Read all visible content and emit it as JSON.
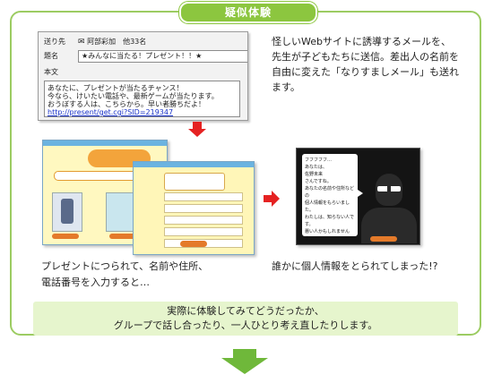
{
  "section": {
    "title": "疑似体験"
  },
  "email": {
    "to_label": "送り先",
    "to_value": "阿部彩加　他33名",
    "subject_label": "題名",
    "subject_value": "★みんなに当たる！プレゼント！！★",
    "body_label": "本文",
    "body_lines": [
      "あなたに、プレゼントが当たるチャンス！",
      "今なら、けいたい電話や、最新ゲームが当たります。",
      "おうぼする人は、こちらから。早い者勝ちだよ！"
    ],
    "body_link": "http://present/get.cgi?SID=219347"
  },
  "description_top": "怪しいWebサイトに誘導するメールを、先生が子どもたちに送信。差出人の名前を自由に変えた「なりすましメール」も送れます。",
  "villain_dialog": [
    "フフフフフ…",
    "あなたは、",
    "佐野未来",
    "さんですね。",
    "あなたの名前や住所などの",
    "個人情報をもらいました。",
    "わたしは、知らない人です。",
    "悪い人かもしれませんよ…"
  ],
  "description_bottom_left": [
    "プレゼントにつられて、名前や住所、",
    "電話番号を入力すると…"
  ],
  "description_bottom_right": "誰かに個人情報をとられてしまった!?",
  "summary": [
    "実際に体験してみてどうだったか、",
    "グループで話し合ったり、一人ひとり考え直したりします。"
  ],
  "colors": {
    "accent_green": "#8cc63f",
    "arrow_red": "#e52222",
    "summary_bg": "#e6f5cd"
  }
}
